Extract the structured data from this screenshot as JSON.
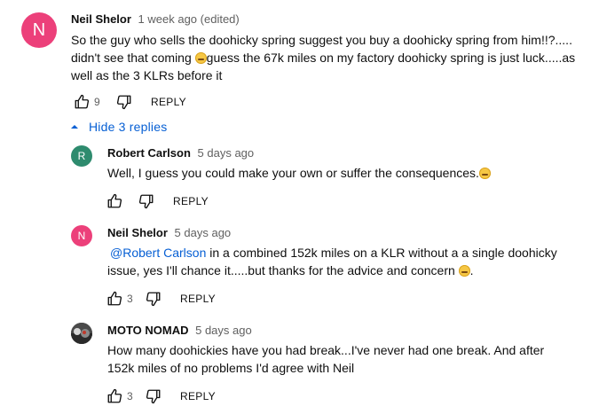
{
  "comments": [
    {
      "author": "Neil Shelor",
      "time": "1 week ago (edited)",
      "avatar_letter": "N",
      "avatar_color": "#ec407a",
      "text_parts": [
        "So the guy who sells the doohicky spring suggest you buy a doohicky spring from him!!?..... didn't see that coming ",
        "guess the 67k miles on my factory doohicky spring is just luck.....as well as the 3 KLRs before it"
      ],
      "likes": "9",
      "reply_label": "REPLY"
    }
  ],
  "replies_toggle": {
    "label": "Hide 3 replies"
  },
  "replies": [
    {
      "author": "Robert Carlson",
      "time": "5 days ago",
      "avatar_letter": "R",
      "avatar_color": "#2e8b6e",
      "text_parts": [
        "Well, I guess you could make your own or suffer the consequences."
      ],
      "likes": "",
      "reply_label": "REPLY"
    },
    {
      "author": "Neil Shelor",
      "time": "5 days ago",
      "avatar_letter": "N",
      "avatar_color": "#ec407a",
      "mention": "@Robert Carlson",
      "text_parts": [
        "  in a combined 152k miles on a KLR without a a single doohicky issue, yes I'll chance it.....but thanks for the advice and concern ",
        "."
      ],
      "likes": "3",
      "reply_label": "REPLY"
    },
    {
      "author": "MOTO NOMAD",
      "time": "5 days ago",
      "avatar_letter": "",
      "avatar_color": "#3a3a3a",
      "text_parts": [
        "How many doohickies have you had break...I've never had one break. And after 152k miles of no problems I'd agree with Neil"
      ],
      "likes": "3",
      "reply_label": "REPLY"
    }
  ]
}
